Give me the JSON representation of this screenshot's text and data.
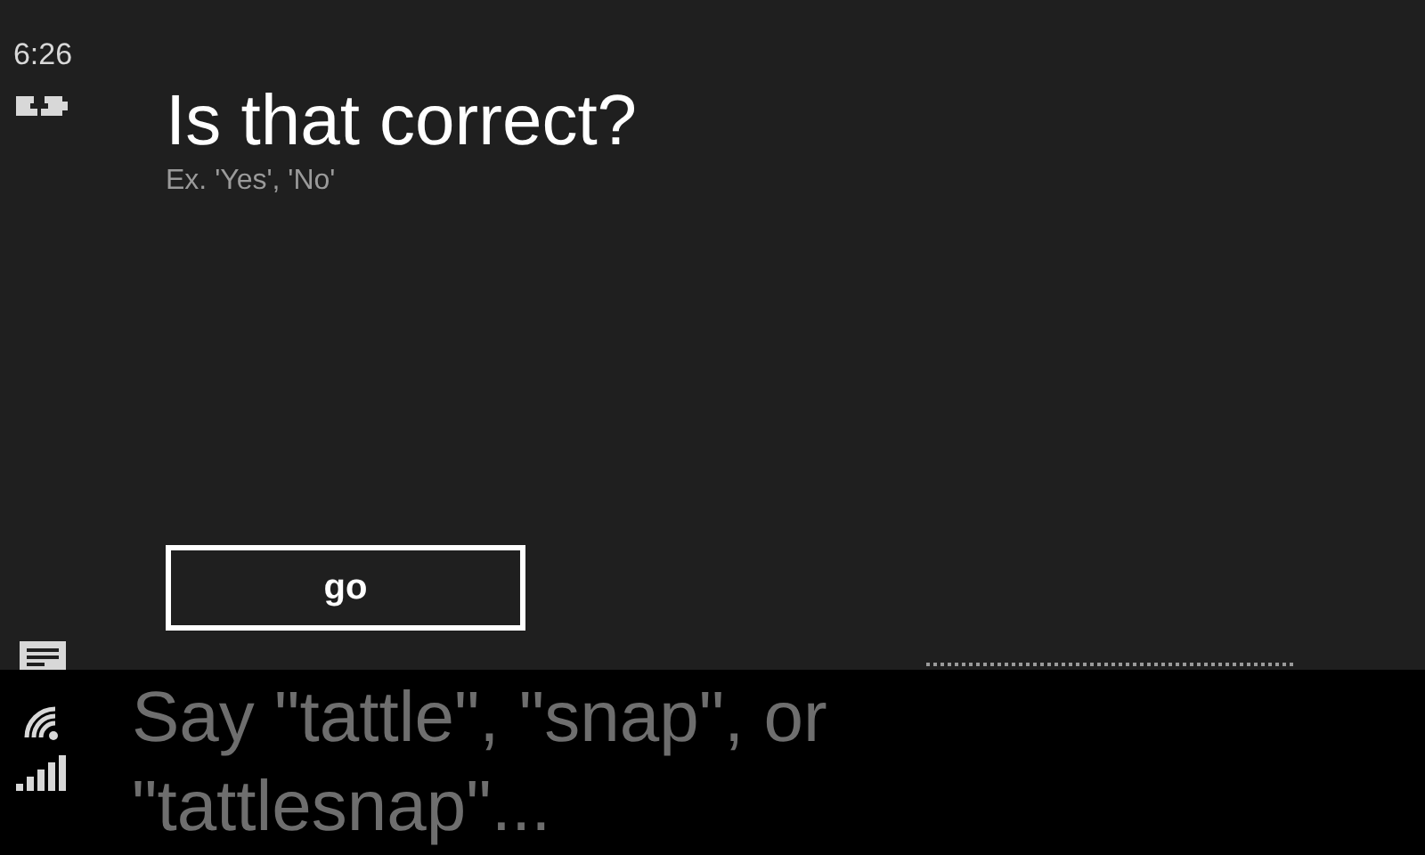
{
  "status_bar": {
    "time": "6:26"
  },
  "prompt": {
    "title": "Is that correct?",
    "hint": "Ex. 'Yes', 'No'"
  },
  "button": {
    "label": "go"
  },
  "speech_panel": {
    "lines": [
      "Say \"tattle\", \"snap\", or",
      "\"tattlesnap\"..."
    ]
  }
}
